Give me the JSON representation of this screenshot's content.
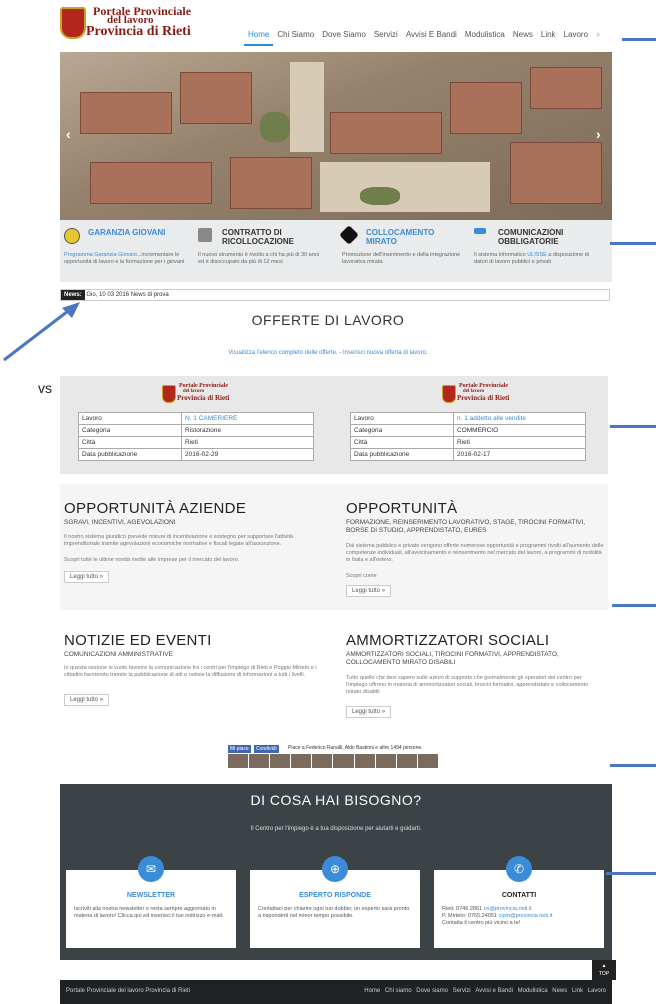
{
  "header": {
    "logo_line1": "Portale Provinciale",
    "logo_line2": "del lavoro",
    "logo_line3": "Provincia di Rieti",
    "nav": [
      "Home",
      "Chi Siamo",
      "Dove Siamo",
      "Servizi",
      "Avvisi E Bandi",
      "Modulistica",
      "News",
      "Link",
      "Lavoro"
    ],
    "search_icon": "search-icon",
    "active_nav": "Home"
  },
  "hero": {
    "prev_icon": "chevron-left-icon",
    "next_icon": "chevron-right-icon",
    "prev_glyph": "‹",
    "next_glyph": "›"
  },
  "services": [
    {
      "title": "GARANZIA GIOVANI",
      "desc_hl": "Programma Garanzia Giovani",
      "desc": "...incrementare le opportunità di lavoro e la formazione per i giovani",
      "color": "#3a8bd8"
    },
    {
      "title": "CONTRATTO DI RICOLLOCAZIONE",
      "desc": "Il nuovo strumento è rivolto a chi ha più di 30 anni ed è disoccupato da più di 12 mesi",
      "color": "#333333"
    },
    {
      "title": "COLLOCAMENTO MIRATO",
      "desc": "Promozione dell'inserimento e della integrazione lavorativa mirata.",
      "color": "#3a8bd8"
    },
    {
      "title": "COMUNICAZIONI OBBLIGATORIE",
      "desc_pre": "Il sistema informatico ",
      "desc_hl": "ULISSE",
      "desc": " a disposizione di datori di lavoro pubblici e privati",
      "color": "#333333"
    }
  ],
  "ticker": {
    "label": "News:",
    "text": "Gio, 10 03 2016 News di prova"
  },
  "offerte": {
    "title": "OFFERTE DI LAVORO",
    "links": "Visualizza l'elenco completo delle offerte. - Inserisci nuova offerta di lavoro."
  },
  "jobs": [
    {
      "rows": [
        [
          "Lavoro",
          "N. 1 CAMERIERE"
        ],
        [
          "Categoria",
          "Ristorazione"
        ],
        [
          "Città",
          "Rieti"
        ],
        [
          "Data pubblicazione",
          "2016-02-29"
        ]
      ]
    },
    {
      "rows": [
        [
          "Lavoro",
          "n. 1 addetto alle vendite"
        ],
        [
          "Categoria",
          "COMMERCIO"
        ],
        [
          "Città",
          "Rieti"
        ],
        [
          "Data pubblicazione",
          "2016-02-17"
        ]
      ]
    }
  ],
  "opps": {
    "aziende_title": "OPPORTUNITÀ AZIENDE",
    "aziende_sub": "SGRAVI, INCENTIVI, AGEVOLAZIONI",
    "aziende_p1": "Il nostro sistema giuridico prevede misure di incentivazione e sostegno per supportare l'attività imprenditoriale tramite agevolazioni economiche normative e fiscali legate all'assunzione.",
    "aziende_p2": "Scopri tutte le ultime novità rivolte alle imprese per il mercato del lavoro.",
    "title": "OPPORTUNITÀ",
    "sub": "FORMAZIONE, REINSERIMENTO LAVORATIVO, STAGE, TIROCINI FORMATIVI, BORSE DI STUDIO, APPRENDISTATO, EURES",
    "p1": "Dal sistema pubblico e privato vengono offerte numerose opportunità e programmi rivolti all'aumento delle competenze individuali, all'avvicinamento e reinserimento nel mercato del lavoro, a programmi di mobilità in Italia e all'estero.",
    "p2": "Scopri come",
    "read_more": "Leggi tutto »"
  },
  "news": {
    "title": "NOTIZIE ED EVENTI",
    "sub": "COMUNICAZIONI AMMINISTRATIVE",
    "p": "In questa sezione si vuole favorire la comunicazione fra i centri per l'impiego di Rieti e Poggio Mirteto e i cittadini favorendo tramite la pubblicazione di atti e notizie la diffusione di informazioni a tutti i livelli.",
    "amm_title": "AMMORTIZZATORI SOCIALI",
    "amm_sub": "AMMORTIZZATORI SOCIALI, TIROCINI FORMATIVI, APPRENDISTATO, COLLOCAMENTO MIRATO DISABILI",
    "amm_p": "Tutto quello che devi sapere sulle azioni di supporto che giornalmente gli operatori del centro per l'impiego offrono in materia di ammortizzatori sociali, tirocini formativi, apprendistato e collocamento mirato disabili",
    "read_more": "Leggi tutto »"
  },
  "social": {
    "like": "Mi piace",
    "share": "Condividi",
    "text": "Piace a Federico Ranalli, Aldo Bastioni e altre 1494 persone."
  },
  "bisogno": {
    "title": "DI COSA HAI BISOGNO?",
    "sub": "Il Centro per l'impiego è a tua disposizione per aiutarti e guidarti.",
    "cards": [
      {
        "title": "NEWSLETTER",
        "desc": "Iscriviti alla nostra newsletter e resta sempre aggiornato in materia di lavoro! Clicca qui ed inserisci il tuo indirizzo e-mail.",
        "icon": "envelope-icon",
        "glyph": "✉",
        "title_color": "#3a8bd8"
      },
      {
        "title": "ESPERTO RISPONDE",
        "desc": "Contattaci per chiarire ogni tuo dubbio; un esperto sarà pronto a risponderti nel minor tempo possibile.",
        "icon": "lifebuoy-icon",
        "glyph": "⊕",
        "title_color": "#3a8bd8"
      },
      {
        "title": "CONTATTI",
        "line1": "Rieti: 0746.2861 ",
        "email1": "cri@provincia.rieti.it",
        "line2": "P. Mirteto: 0765.24051 ",
        "email2": "cipm@provincia.rieti.it",
        "line3": "Contatta il centro più vicino a te!",
        "icon": "phone-icon",
        "glyph": "✆",
        "title_color": "#222222"
      }
    ]
  },
  "top_button": "TOP",
  "footer": {
    "left": "Portale Provinciale del lavoro Provincia di Rieti",
    "links": [
      "Home",
      "Chi siamo",
      "Dove siamo",
      "Servizi",
      "Avvisi e Bandi",
      "Modulistica",
      "News",
      "Link",
      "Lavoro"
    ]
  },
  "annotation": {
    "fragment": "vs"
  },
  "colors": {
    "accent": "#3a8bd8",
    "brand": "#8a1a14",
    "annotation": "#4a76c3"
  }
}
